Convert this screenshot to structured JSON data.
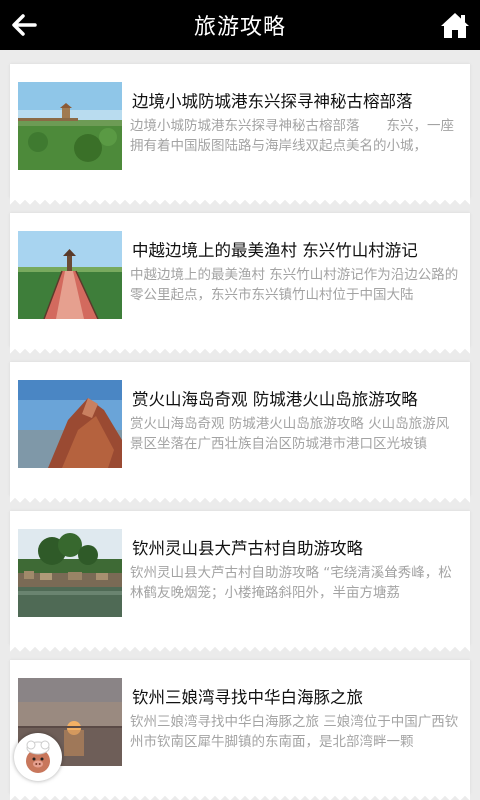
{
  "header": {
    "title": "旅游攻略",
    "back_icon": "arrow-left-icon",
    "home_icon": "home-icon"
  },
  "articles": [
    {
      "title": "边境小城防城港东兴探寻神秘古榕部落",
      "desc": "边境小城防城港东兴探寻神秘古榕部落　　东兴，一座拥有着中国版图陆路与海岸线双起点美名的小城，"
    },
    {
      "title": "中越边境上的最美渔村 东兴竹山村游记",
      "desc": "中越边境上的最美渔村 东兴竹山村游记作为沿边公路的零公里起点，东兴市东兴镇竹山村位于中国大陆"
    },
    {
      "title": "赏火山海岛奇观 防城港火山岛旅游攻略",
      "desc": "赏火山海岛奇观 防城港火山岛旅游攻略 火山岛旅游风景区坐落在广西壮族自治区防城港市港口区光坡镇"
    },
    {
      "title": "钦州灵山县大芦古村自助游攻略",
      "desc": "钦州灵山县大芦古村自助游攻略 “宅绕清溪耸秀峰，松林鹤友晚烟笼；小楼掩路斜阳外，半亩方塘荔"
    },
    {
      "title": "钦州三娘湾寻找中华白海豚之旅",
      "desc": "钦州三娘湾寻找中华白海豚之旅 三娘湾位于中国广西钦州市钦南区犀牛脚镇的东南面，是北部湾畔一颗"
    }
  ],
  "floating": {
    "icon": "chef-avatar-icon"
  },
  "colors": {
    "header_bg": "#000000",
    "page_bg": "#ebebeb",
    "title_text": "#111111",
    "desc_text": "#a3a3a3"
  }
}
